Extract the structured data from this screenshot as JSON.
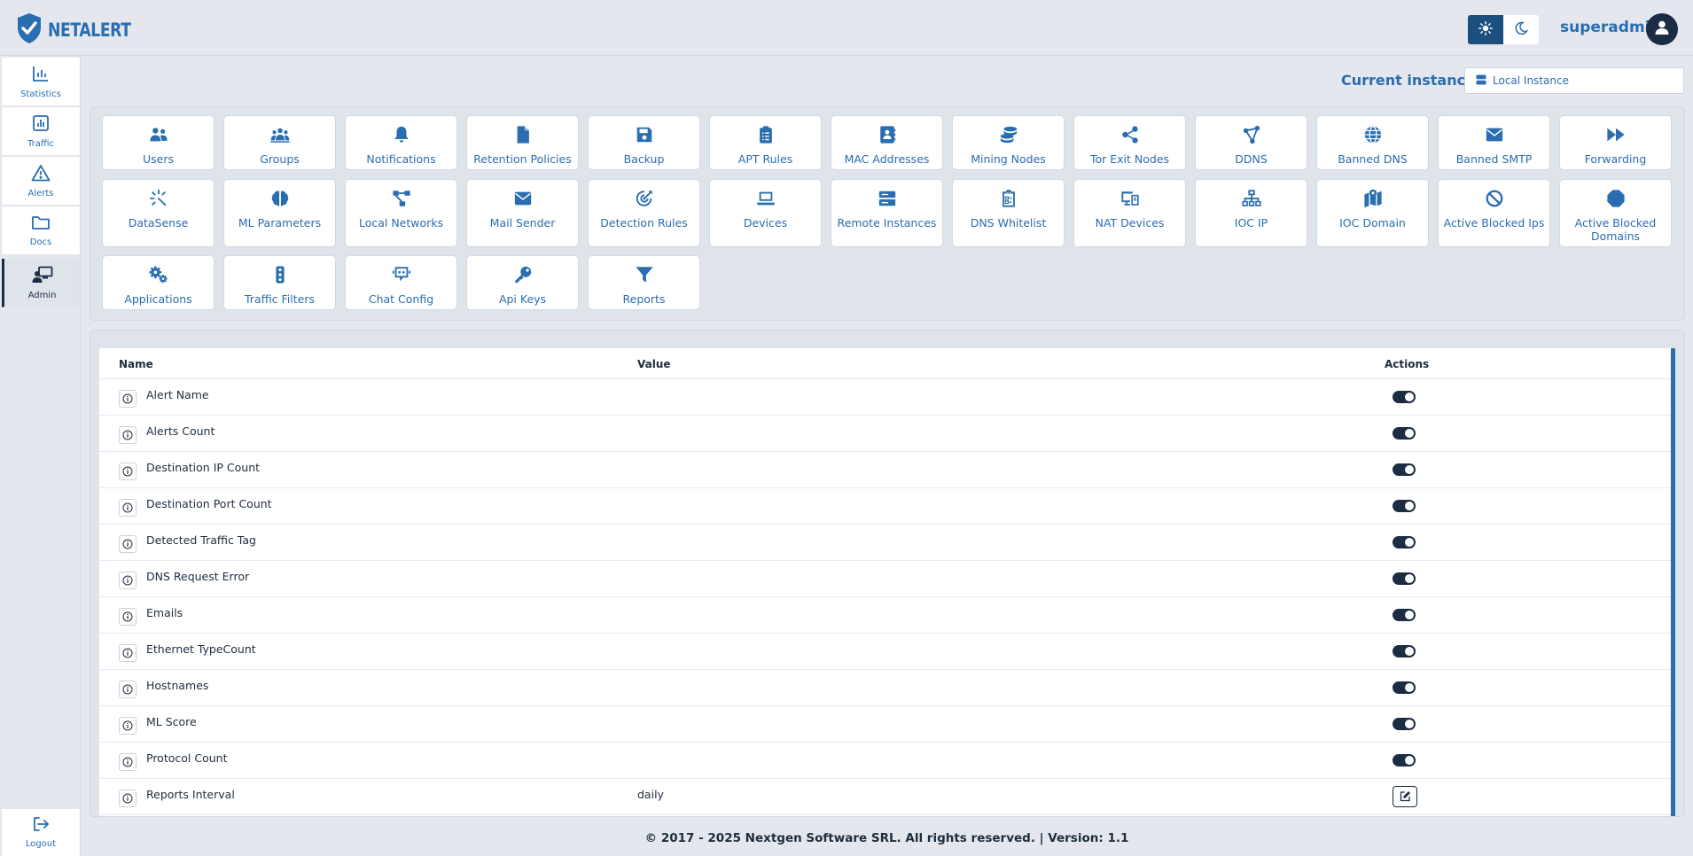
{
  "app": {
    "logo_text": "NETALERT"
  },
  "header": {
    "username": "superadmin"
  },
  "sidebar": {
    "items": [
      {
        "label": "Statistics",
        "icon": "chart-bar-icon"
      },
      {
        "label": "Traffic",
        "icon": "chart-line-icon"
      },
      {
        "label": "Alerts",
        "icon": "warning-icon"
      },
      {
        "label": "Docs",
        "icon": "folder-icon"
      },
      {
        "label": "Admin",
        "icon": "admin-screen-icon",
        "active": true
      }
    ],
    "logout_label": "Logout"
  },
  "instance": {
    "label": "Current instance:",
    "selected": "Local Instance"
  },
  "tiles": [
    {
      "label": "Users",
      "icon": "users-icon"
    },
    {
      "label": "Groups",
      "icon": "groups-icon"
    },
    {
      "label": "Notifications",
      "icon": "bell-icon"
    },
    {
      "label": "Retention Policies",
      "icon": "file-icon"
    },
    {
      "label": "Backup",
      "icon": "floppy-disk-icon"
    },
    {
      "label": "APT Rules",
      "icon": "clipboard-list-icon"
    },
    {
      "label": "MAC Addresses",
      "icon": "address-book-icon"
    },
    {
      "label": "Mining Nodes",
      "icon": "coins-icon"
    },
    {
      "label": "Tor Exit Nodes",
      "icon": "share-nodes-icon"
    },
    {
      "label": "DDNS",
      "icon": "bezier-icon"
    },
    {
      "label": "Banned DNS",
      "icon": "globe-icon"
    },
    {
      "label": "Banned SMTP",
      "icon": "envelope-icon"
    },
    {
      "label": "Forwarding",
      "icon": "forward-icon"
    },
    {
      "label": "DataSense",
      "icon": "wand-sparkles-icon"
    },
    {
      "label": "ML Parameters",
      "icon": "brain-icon"
    },
    {
      "label": "Local Networks",
      "icon": "network-diagram-icon"
    },
    {
      "label": "Mail Sender",
      "icon": "envelope-icon"
    },
    {
      "label": "Detection Rules",
      "icon": "bullseye-icon"
    },
    {
      "label": "Devices",
      "icon": "laptop-icon"
    },
    {
      "label": "Remote Instances",
      "icon": "server-icon"
    },
    {
      "label": "DNS Whitelist",
      "icon": "clipboard-check-icon"
    },
    {
      "label": "NAT Devices",
      "icon": "computer-icon"
    },
    {
      "label": "IOC IP",
      "icon": "sitemap-icon"
    },
    {
      "label": "IOC Domain",
      "icon": "map-location-icon"
    },
    {
      "label": "Active Blocked Ips",
      "icon": "ban-icon"
    },
    {
      "label": "Active Blocked Domains",
      "icon": "octagon-icon"
    },
    {
      "label": "Applications",
      "icon": "gears-icon"
    },
    {
      "label": "Traffic Filters",
      "icon": "traffic-light-icon"
    },
    {
      "label": "Chat Config",
      "icon": "robot-chat-icon"
    },
    {
      "label": "Api Keys",
      "icon": "key-icon"
    },
    {
      "label": "Reports",
      "icon": "filter-icon"
    }
  ],
  "table": {
    "headers": {
      "name": "Name",
      "value": "Value",
      "actions": "Actions"
    },
    "rows": [
      {
        "name": "Alert Name",
        "value": "",
        "action": "toggle",
        "enabled": true
      },
      {
        "name": "Alerts Count",
        "value": "",
        "action": "toggle",
        "enabled": true
      },
      {
        "name": "Destination IP Count",
        "value": "",
        "action": "toggle",
        "enabled": true
      },
      {
        "name": "Destination Port Count",
        "value": "",
        "action": "toggle",
        "enabled": true
      },
      {
        "name": "Detected Traffic Tag",
        "value": "",
        "action": "toggle",
        "enabled": true
      },
      {
        "name": "DNS Request Error",
        "value": "",
        "action": "toggle",
        "enabled": true
      },
      {
        "name": "Emails",
        "value": "",
        "action": "toggle",
        "enabled": true
      },
      {
        "name": "Ethernet TypeCount",
        "value": "",
        "action": "toggle",
        "enabled": true
      },
      {
        "name": "Hostnames",
        "value": "",
        "action": "toggle",
        "enabled": true
      },
      {
        "name": "ML Score",
        "value": "",
        "action": "toggle",
        "enabled": true
      },
      {
        "name": "Protocol Count",
        "value": "",
        "action": "toggle",
        "enabled": true
      },
      {
        "name": "Reports Interval",
        "value": "daily",
        "action": "edit"
      }
    ]
  },
  "footer": {
    "text": "© 2017 - 2025 Nextgen Software SRL. All rights reserved. | Version: 1.1"
  },
  "colors": {
    "accent": "#2a6db0",
    "dark": "#1b2c44",
    "background": "#e4e8ee"
  }
}
